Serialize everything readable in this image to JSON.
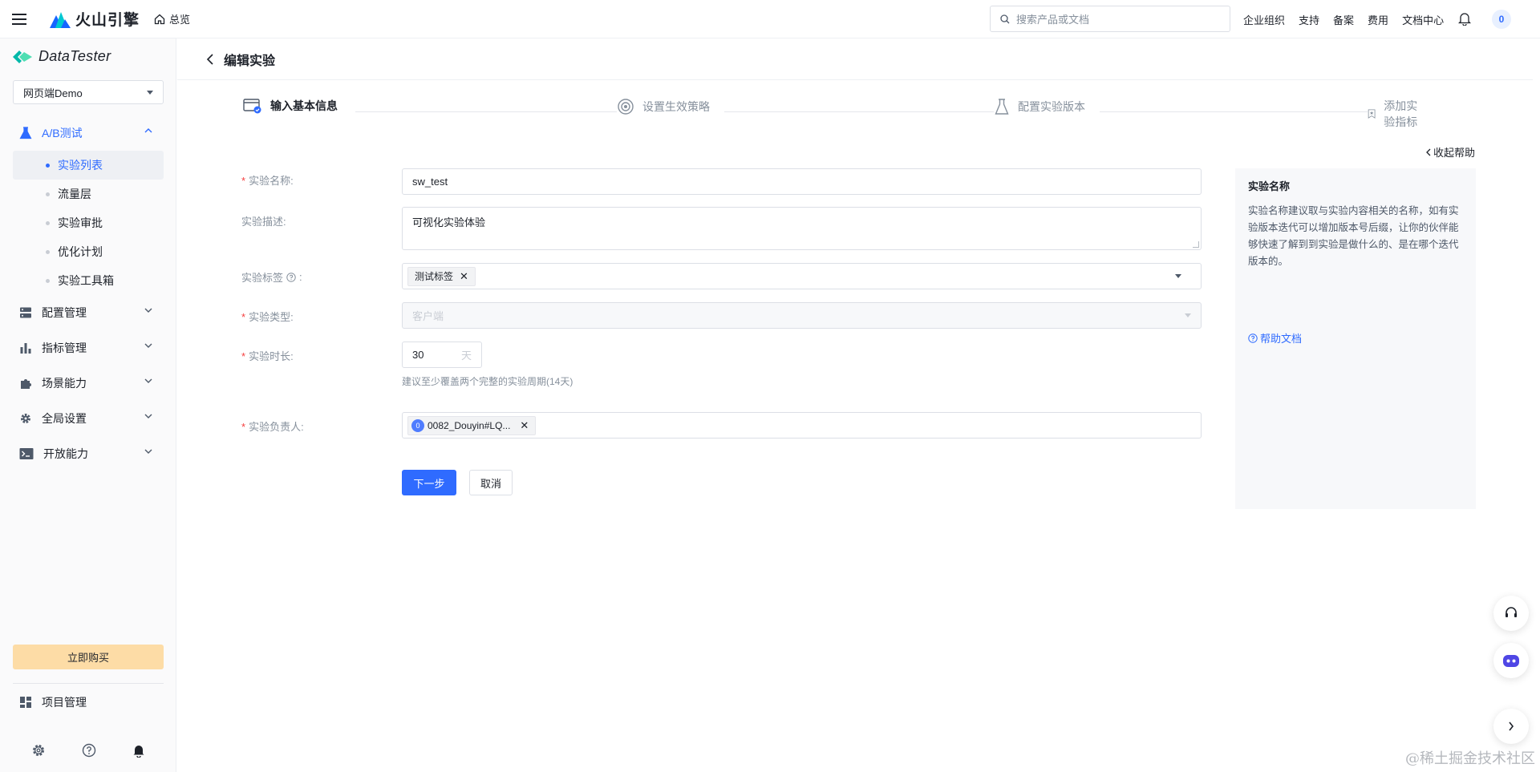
{
  "topbar": {
    "brand": "火山引擎",
    "overview": "总览",
    "search_placeholder": "搜索产品或文档",
    "links": [
      "企业组织",
      "支持",
      "备案",
      "费用",
      "文档中心"
    ],
    "avatar": "0"
  },
  "sidebar": {
    "app_name": "DataTester",
    "project": "网页端Demo",
    "groups": [
      {
        "label": "A/B测试",
        "active": true,
        "icon": "flask-icon"
      },
      {
        "label": "配置管理",
        "icon": "server-icon"
      },
      {
        "label": "指标管理",
        "icon": "bar-chart-icon"
      },
      {
        "label": "场景能力",
        "icon": "puzzle-icon"
      },
      {
        "label": "全局设置",
        "icon": "gear-icon"
      },
      {
        "label": "开放能力",
        "icon": "terminal-icon"
      }
    ],
    "ab_items": [
      "实验列表",
      "流量层",
      "实验审批",
      "优化计划",
      "实验工具箱"
    ],
    "buy": "立即购买",
    "project_mgmt": "项目管理"
  },
  "page": {
    "title": "编辑实验",
    "steps": [
      "输入基本信息",
      "设置生效策略",
      "配置实验版本",
      "添加实验指标"
    ]
  },
  "form": {
    "name_label": "实验名称:",
    "name_value": "sw_test",
    "desc_label": "实验描述:",
    "desc_value": "可视化实验体验",
    "tags_label": "实验标签",
    "tags_suffix": ":",
    "tag_value": "测试标签",
    "type_label": "实验类型:",
    "type_value": "客户端",
    "duration_label": "实验时长:",
    "duration_value": "30",
    "duration_unit": "天",
    "duration_hint": "建议至少覆盖两个完整的实验周期(14天)",
    "owner_label": "实验负责人:",
    "owner_value": "0082_Douyin#LQ...",
    "owner_avatar": "0",
    "next": "下一步",
    "cancel": "取消"
  },
  "help": {
    "toggle": "收起帮助",
    "title": "实验名称",
    "text": "实验名称建议取与实验内容相关的名称，如有实验版本迭代可以增加版本号后缀，让你的伙伴能够快速了解到到实验是做什么的、是在哪个迭代版本的。",
    "link": "帮助文档"
  },
  "watermark": "@稀土掘金技术社区",
  "colors": {
    "primary": "#2f6bff",
    "required": "#f53f3f",
    "buy": "#fddca6"
  }
}
